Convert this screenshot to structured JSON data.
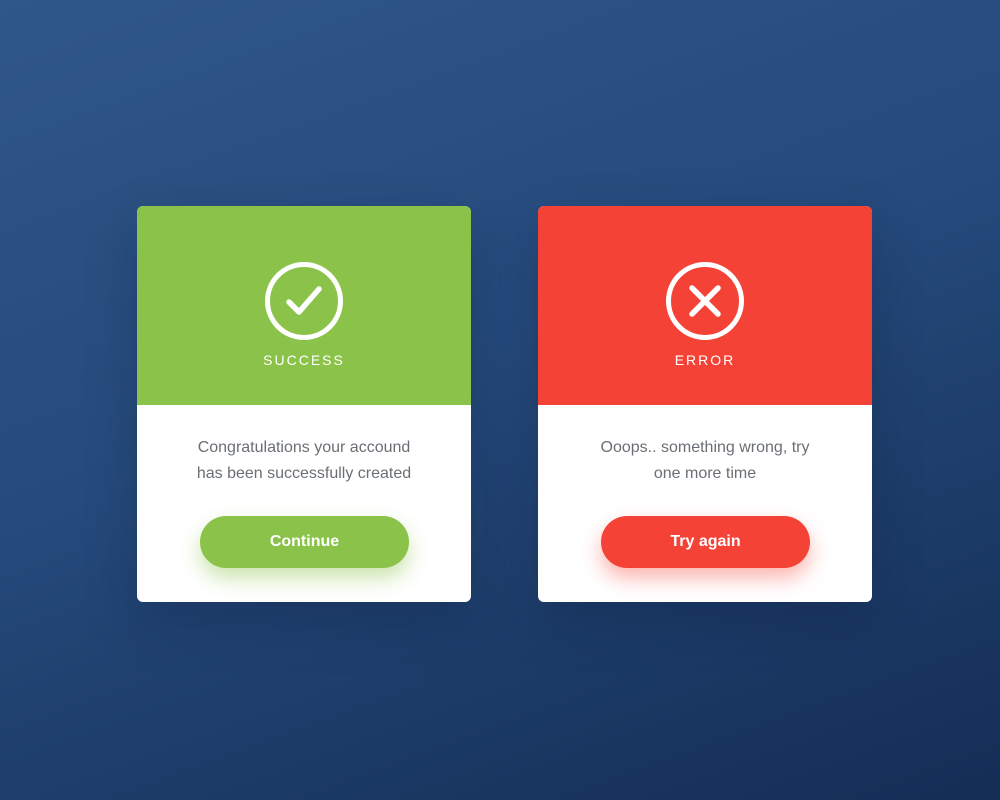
{
  "colors": {
    "success": "#8bc34a",
    "error": "#f44336",
    "background_top": "#2f5787",
    "background_bottom": "#142d55",
    "card": "#ffffff",
    "message_text": "#6a6f75"
  },
  "success_card": {
    "icon": "checkmark-circle-icon",
    "title": "SUCCESS",
    "message_line1": "Congratulations your accound",
    "message_line2": "has been successfully created",
    "button_label": "Continue"
  },
  "error_card": {
    "icon": "x-circle-icon",
    "title": "ERROR",
    "message_line1": "Ooops.. something wrong, try",
    "message_line2": "one more time",
    "button_label": "Try again"
  }
}
